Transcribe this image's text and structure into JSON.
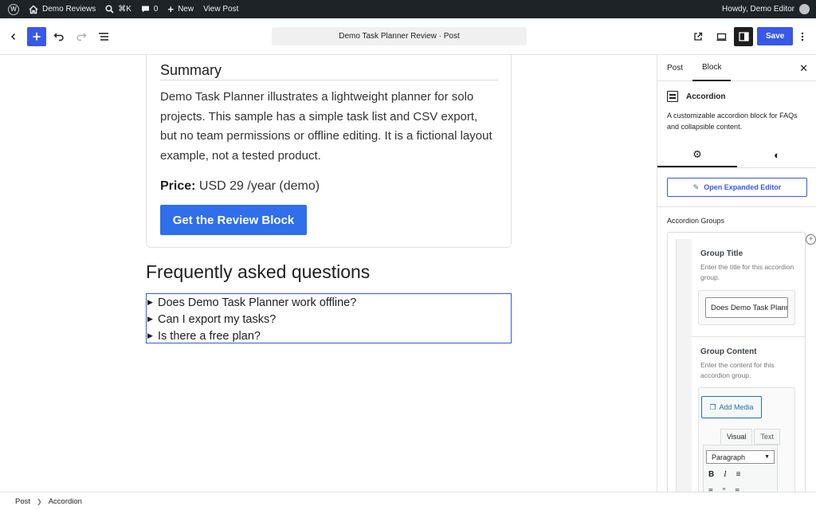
{
  "adminbar": {
    "site_name": "Demo Reviews",
    "search_shortcut": "⌘K",
    "comments_count": "0",
    "new_label": "New",
    "view_post": "View Post",
    "greeting": "Howdy, Demo Editor"
  },
  "header": {
    "document_title": "Demo Task Planner Review · Post",
    "save_label": "Save"
  },
  "content": {
    "summary_title": "Summary",
    "summary_text": "Demo Task Planner illustrates a lightweight planner for solo projects. This sample has a simple task list and CSV export, but no team permissions or offline editing. It is a fictional layout example, not a tested product.",
    "price_label": "Price:",
    "price_value": "USD 29 /year (demo)",
    "cta_label": "Get the Review Block",
    "faq_title": "Frequently asked questions",
    "faq_items": [
      "Does Demo Task Planner work offline?",
      "Can I export my tasks?",
      "Is there a free plan?"
    ]
  },
  "sidebar": {
    "tabs": [
      "Post",
      "Block"
    ],
    "active_tab": "Block",
    "block_name": "Accordion",
    "block_description": "A customizable accordion block for FAQs and collapsible content.",
    "expanded_editor_label": "Open Expanded Editor",
    "groups_label": "Accordion Groups",
    "group_title_heading": "Group Title",
    "group_title_help": "Enter the title for this accordion group.",
    "group_title_value": "Does Demo Task Planner work offline?",
    "group_content_heading": "Group Content",
    "group_content_help": "Enter the content for this accordion group.",
    "add_media_label": "Add Media",
    "editor_tabs": [
      "Visual",
      "Text"
    ],
    "format_select": "Paragraph"
  },
  "footer": {
    "breadcrumbs": [
      "Post",
      "Accordion"
    ]
  },
  "colors": {
    "accent": "#3858e9",
    "cta": "#2f6fea",
    "adminbar": "#1d2327"
  }
}
